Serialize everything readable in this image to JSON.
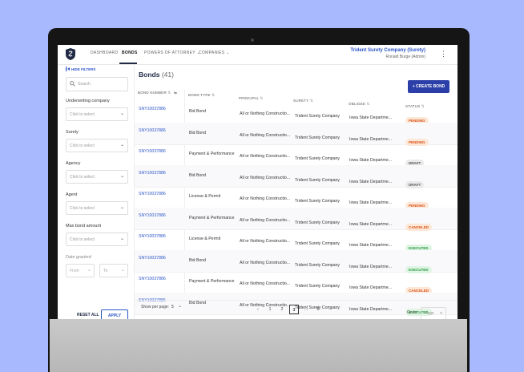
{
  "nav": {
    "items": [
      "DASHBOARD",
      "BONDS",
      "POWERS OF ATTORNEY",
      "COMPANIES"
    ],
    "company": "Trident Surety Company (Surety)",
    "user": "Ronald Burge (Admin)"
  },
  "sidebar": {
    "hide_filters": "HIDE FILTERS",
    "search_placeholder": "Search",
    "filters": [
      {
        "label": "Underwriting company",
        "placeholder": "Click to select"
      },
      {
        "label": "Surety",
        "placeholder": "Click to select"
      },
      {
        "label": "Agency",
        "placeholder": "Click to select"
      },
      {
        "label": "Agent",
        "placeholder": "Click to select"
      },
      {
        "label": "Max bond amount",
        "placeholder": "Click to select"
      }
    ],
    "date_label": "Date granted",
    "from_placeholder": "From",
    "to_placeholder": "To",
    "reset": "RESET ALL",
    "apply": "APPLY"
  },
  "main": {
    "title": "Bonds",
    "count": "(41)",
    "create_button": "+ CREATE BOND",
    "columns": [
      "BOND NUMBER",
      "BOND TYPE",
      "PRINCIPAL",
      "SURETY",
      "OBLIGEE",
      "STATUS"
    ],
    "rows": [
      {
        "number": "SNY10037886",
        "type": "Bid Bond",
        "principal": "All or Nothing Constructio...",
        "surety": "Trident Surety Company",
        "obligee": "Iowa State Departme...",
        "status": "PENDING",
        "status_class": "pending"
      },
      {
        "number": "SNY10037886",
        "type": "Bid Bond",
        "principal": "All or Nothing Constructio...",
        "surety": "Trident Surety Company",
        "obligee": "Iowa State Departme...",
        "status": "PENDING",
        "status_class": "pending"
      },
      {
        "number": "SNY10037886",
        "type": "Payment & Performance",
        "principal": "All or Nothing Constructio...",
        "surety": "Trident Surety Company",
        "obligee": "Iowa State Departme...",
        "status": "DRAFT",
        "status_class": "draft"
      },
      {
        "number": "SNY10037886",
        "type": "Bid Bond",
        "principal": "All or Nothing Constructio...",
        "surety": "Trident Surety Company",
        "obligee": "Iowa State Departme...",
        "status": "DRAFT",
        "status_class": "draft"
      },
      {
        "number": "SNY10037886",
        "type": "License & Permit",
        "principal": "All or Nothing Constructio...",
        "surety": "Trident Surety Company",
        "obligee": "Iowa State Departme...",
        "status": "PENDING",
        "status_class": "pending"
      },
      {
        "number": "SNY10037886",
        "type": "Payment & Performance",
        "principal": "All or Nothing Constructio...",
        "surety": "Trident Surety Company",
        "obligee": "Iowa State Departme...",
        "status": "CANCELED",
        "status_class": "canceled"
      },
      {
        "number": "SNY10037886",
        "type": "License & Permit",
        "principal": "All or Nothing Constructio...",
        "surety": "Trident Surety Company",
        "obligee": "Iowa State Departme...",
        "status": "EXECUTED",
        "status_class": "executed"
      },
      {
        "number": "SNY10037886",
        "type": "Bid Bond",
        "principal": "All or Nothing Constructio...",
        "surety": "Trident Surety Company",
        "obligee": "Iowa State Departme...",
        "status": "EXECUTED",
        "status_class": "executed"
      },
      {
        "number": "SNY10037886",
        "type": "Payment & Performance",
        "principal": "All or Nothing Constructio...",
        "surety": "Trident Surety Company",
        "obligee": "Iowa State Departme...",
        "status": "CANCELED",
        "status_class": "canceled"
      },
      {
        "number": "SNY10037886",
        "type": "Bid Bond",
        "principal": "All or Nothing Constructio...",
        "surety": "Trident Surety Company",
        "obligee": "Iowa State Departme...",
        "status": "EXECUTED",
        "status_class": "executed"
      }
    ]
  },
  "footer": {
    "show_per_page": "Show per page:",
    "per_page_value": "5",
    "pages": [
      "1",
      "2",
      "3",
      "...",
      "6"
    ],
    "current_page": "3",
    "goto_label": "Go to:",
    "goto_placeholder": "Page"
  },
  "colors": {
    "background": "#a8b9fd",
    "accent": "#2c3fa8",
    "link": "#2c55c9"
  }
}
